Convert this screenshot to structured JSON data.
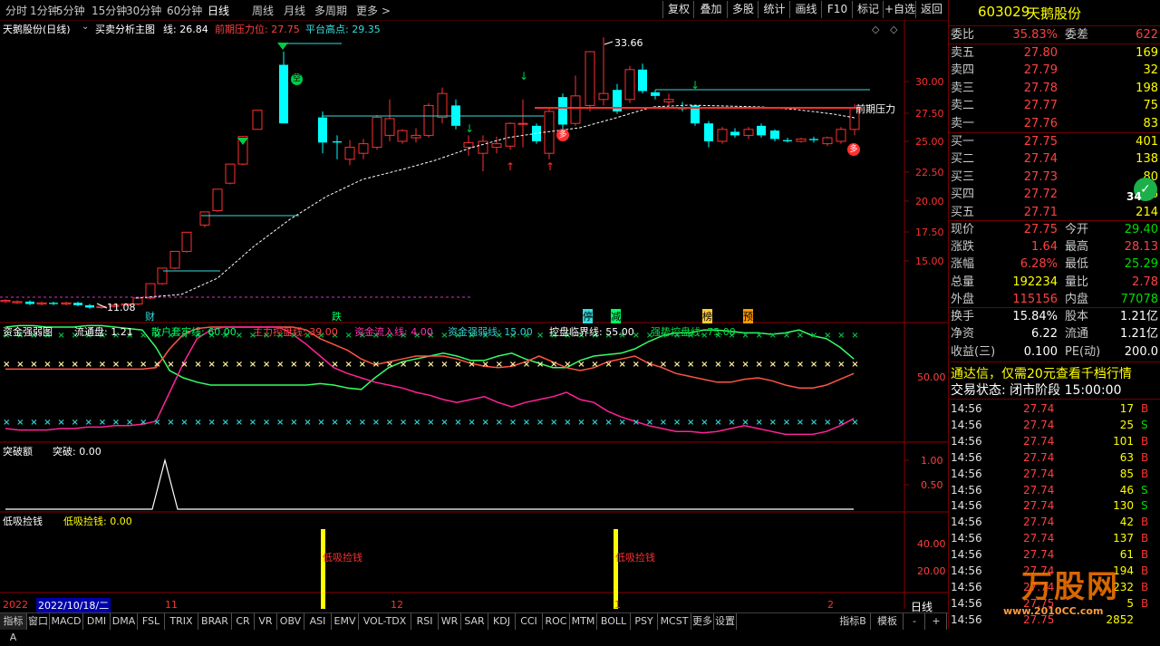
{
  "toolbar": {
    "periods": [
      "分时",
      "1分钟",
      "5分钟",
      "15分钟",
      "30分钟",
      "60分钟",
      "日线",
      "周线",
      "月线",
      "多周期",
      "更多 >"
    ],
    "active_period": "日线",
    "buttons": [
      "复权",
      "叠加",
      "多股",
      "统计",
      "画线",
      "F10",
      "标记",
      "+自选",
      "返回"
    ]
  },
  "main_panel": {
    "title": "天鹅股份(日线)",
    "indicator": "买卖分析主图",
    "line_label": "线: 26.84",
    "pressure_label": "前期压力位: 27.75",
    "platform_label": "平台高点: 29.35",
    "high_mark": "33.66",
    "low_mark": "11.08",
    "pressure_text": "前期压力",
    "y_ticks": [
      "30.00",
      "27.50",
      "25.00",
      "22.50",
      "20.00",
      "17.50",
      "15.00"
    ],
    "markers": {
      "cai": "财",
      "die": "跌",
      "ting": "停",
      "jian": "减",
      "bang": "榜",
      "yu": "预",
      "kong": "空",
      "duo1": "多",
      "duo2": "多"
    }
  },
  "panel2": {
    "title": "资金强弱图",
    "items": [
      {
        "label": "流通盘: 1.21",
        "color": "#ffffff"
      },
      {
        "label": "散户套牢线: 60.00",
        "color": "#00ff66"
      },
      {
        "label": "主力控盘线: 39.00",
        "color": "#ff4040"
      },
      {
        "label": "资金流入线: 4.00",
        "color": "#ff33aa"
      },
      {
        "label": "资金强弱线: 15.00",
        "color": "#33cccc"
      },
      {
        "label": "控盘临界线: 55.00",
        "color": "#ffffff"
      },
      {
        "label": "强势控盘线: 75.00",
        "color": "#00dd44"
      }
    ],
    "y_tick": "50.00"
  },
  "panel3": {
    "title": "突破额",
    "value_label": "突破: 0.00",
    "y_ticks": [
      "1.00",
      "0.50"
    ]
  },
  "panel4": {
    "title": "低吸捡钱",
    "value_label": "低吸捡钱: 0.00",
    "marker": "低吸捡钱",
    "y_ticks": [
      "40.00",
      "20.00"
    ]
  },
  "xaxis": {
    "start_label": "2022/10/18/二",
    "partial": "2022",
    "months": [
      "11",
      "12",
      "1",
      "2"
    ]
  },
  "stock": {
    "code": "603029",
    "name": "天鹅股份"
  },
  "order_book": {
    "weibi_label": "委比",
    "weibi": "35.83%",
    "weicha_label": "委差",
    "weicha": "622",
    "asks": [
      {
        "label": "卖五",
        "price": "27.80",
        "vol": "169"
      },
      {
        "label": "卖四",
        "price": "27.79",
        "vol": "32"
      },
      {
        "label": "卖三",
        "price": "27.78",
        "vol": "198"
      },
      {
        "label": "卖二",
        "price": "27.77",
        "vol": "75"
      },
      {
        "label": "卖一",
        "price": "27.76",
        "vol": "83"
      }
    ],
    "bids": [
      {
        "label": "买一",
        "price": "27.75",
        "vol": "401"
      },
      {
        "label": "买二",
        "price": "27.74",
        "vol": "138"
      },
      {
        "label": "买三",
        "price": "27.73",
        "vol": "80"
      },
      {
        "label": "买四",
        "price": "27.72",
        "vol": "246"
      },
      {
        "label": "买五",
        "price": "27.71",
        "vol": "214"
      }
    ]
  },
  "quote": [
    {
      "k": "现价",
      "v": "27.75",
      "vc": "red",
      "k2": "今开",
      "v2": "29.40",
      "v2c": "grn"
    },
    {
      "k": "涨跌",
      "v": "1.64",
      "vc": "red",
      "k2": "最高",
      "v2": "28.13",
      "v2c": "red"
    },
    {
      "k": "涨幅",
      "v": "6.28%",
      "vc": "red",
      "k2": "最低",
      "v2": "25.29",
      "v2c": "grn"
    },
    {
      "k": "总量",
      "v": "192234",
      "vc": "yel",
      "k2": "量比",
      "v2": "2.78",
      "v2c": "red"
    },
    {
      "k": "外盘",
      "v": "115156",
      "vc": "red",
      "k2": "内盘",
      "v2": "77078",
      "v2c": "grn"
    }
  ],
  "fundamentals": [
    {
      "k": "换手",
      "v": "15.84%",
      "k2": "股本",
      "v2": "1.21亿"
    },
    {
      "k": "净资",
      "v": "6.22",
      "k2": "流通",
      "v2": "1.21亿"
    },
    {
      "k": "收益(三)",
      "v": "0.100",
      "k2": "PE(动)",
      "v2": "200.0"
    }
  ],
  "ad": "通达信，仅需20元查看千档行情",
  "trade_status": "交易状态: 闭市阶段 15:00:00",
  "ticks": [
    {
      "t": "14:56",
      "p": "27.74",
      "q": "17",
      "s": "B"
    },
    {
      "t": "14:56",
      "p": "27.74",
      "q": "25",
      "s": "S"
    },
    {
      "t": "14:56",
      "p": "27.74",
      "q": "101",
      "s": "B"
    },
    {
      "t": "14:56",
      "p": "27.74",
      "q": "63",
      "s": "B"
    },
    {
      "t": "14:56",
      "p": "27.74",
      "q": "85",
      "s": "B"
    },
    {
      "t": "14:56",
      "p": "27.74",
      "q": "46",
      "s": "S"
    },
    {
      "t": "14:56",
      "p": "27.74",
      "q": "130",
      "s": "S"
    },
    {
      "t": "14:56",
      "p": "27.74",
      "q": "42",
      "s": "B"
    },
    {
      "t": "14:56",
      "p": "27.74",
      "q": "137",
      "s": "B"
    },
    {
      "t": "14:56",
      "p": "27.74",
      "q": "61",
      "s": "B"
    },
    {
      "t": "14:56",
      "p": "27.74",
      "q": "194",
      "s": "B"
    },
    {
      "t": "14:56",
      "p": "27.74",
      "q": "232",
      "s": "B"
    },
    {
      "t": "14:56",
      "p": "27.75",
      "q": "5",
      "s": "B"
    },
    {
      "t": "14:56",
      "p": "27.75",
      "q": "2852",
      "s": ""
    }
  ],
  "security_badge": "34",
  "watermark": {
    "brand": "万股网",
    "url": "www.2010CC.com"
  },
  "bottom_tabs": [
    "指标A",
    "窗口",
    "MACD",
    "DMI",
    "DMA",
    "FSL",
    "TRIX",
    "BRAR",
    "CR",
    "VR",
    "OBV",
    "ASI",
    "EMV",
    "VOL-TDX",
    "RSI",
    "WR",
    "SAR",
    "KDJ",
    "CCI",
    "ROC",
    "MTM",
    "BOLL",
    "PSY",
    "MCST",
    "更多",
    "设置"
  ],
  "bottom_right": [
    "指标B",
    "模板",
    "-",
    "+"
  ],
  "day_label": "日线",
  "colors": {
    "up": "#ff3030",
    "down": "#00ffff",
    "axis": "#8b0000",
    "grid_text": "#ff3030"
  }
}
